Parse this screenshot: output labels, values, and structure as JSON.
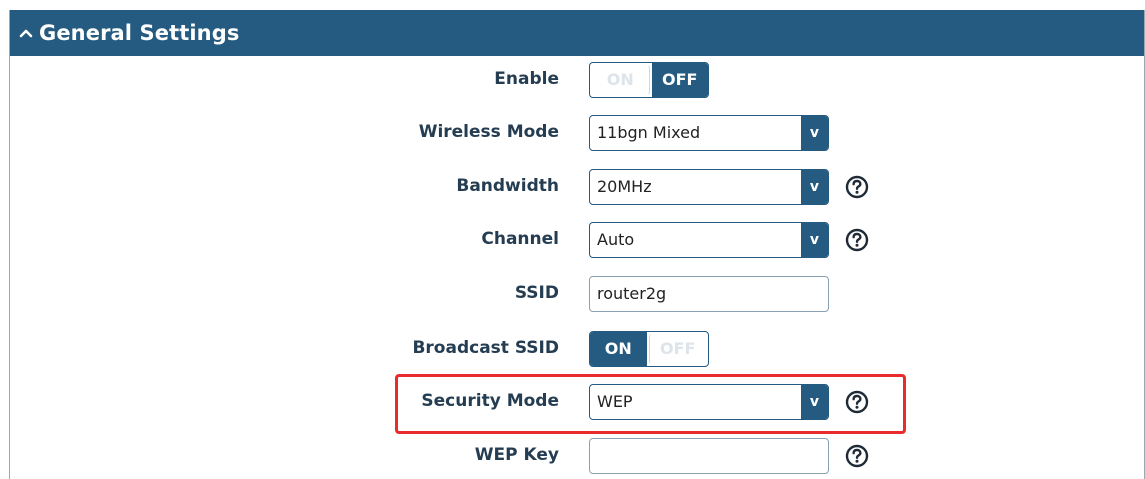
{
  "section": {
    "title": "General Settings",
    "collapse_icon": "chevron-up-icon"
  },
  "fields": {
    "enable": {
      "label": "Enable",
      "on": "ON",
      "off": "OFF",
      "state": "OFF"
    },
    "wireless_mode": {
      "label": "Wireless Mode",
      "value": "11bgn Mixed",
      "arrow": "v"
    },
    "bandwidth": {
      "label": "Bandwidth",
      "value": "20MHz",
      "arrow": "v"
    },
    "channel": {
      "label": "Channel",
      "value": "Auto",
      "arrow": "v"
    },
    "ssid": {
      "label": "SSID",
      "value": "router2g"
    },
    "broadcast_ssid": {
      "label": "Broadcast SSID",
      "on": "ON",
      "off": "OFF",
      "state": "ON"
    },
    "security_mode": {
      "label": "Security Mode",
      "value": "WEP",
      "arrow": "v",
      "highlighted": true
    },
    "wep_key": {
      "label": "WEP Key",
      "value": ""
    }
  },
  "colors": {
    "header": "#255b80",
    "label": "#253d52",
    "highlight": "#ea2b2b"
  }
}
